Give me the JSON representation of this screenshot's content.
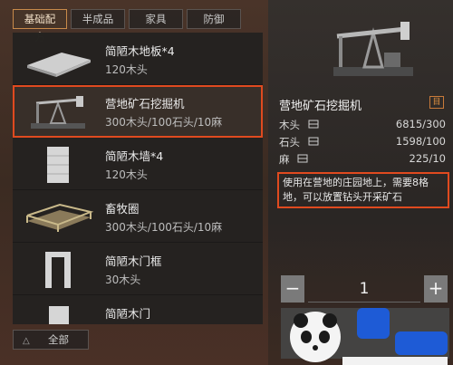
{
  "tabs": [
    {
      "label": "基础配方",
      "active": true
    },
    {
      "label": "半成品",
      "active": false
    },
    {
      "label": "家具",
      "active": false
    },
    {
      "label": "防御",
      "active": false
    }
  ],
  "recipes": [
    {
      "name": "简陋木地板*4",
      "cost": "120木头",
      "thumb": "floor-icon"
    },
    {
      "name": "营地矿石挖掘机",
      "cost": "300木头/100石头/10麻",
      "thumb": "pumpjack-icon",
      "selected": true
    },
    {
      "name": "简陋木墙*4",
      "cost": "120木头",
      "thumb": "wall-icon"
    },
    {
      "name": "畜牧圈",
      "cost": "300木头/100石头/10麻",
      "thumb": "pen-icon"
    },
    {
      "name": "简陋木门框",
      "cost": "30木头",
      "thumb": "doorframe-icon"
    },
    {
      "name": "简陋木门",
      "cost": "",
      "thumb": "door-icon"
    }
  ],
  "all_button": {
    "label": "全部"
  },
  "detail": {
    "title": "营地矿石挖掘机",
    "resources": [
      {
        "name": "木头",
        "value": "6815/300"
      },
      {
        "name": "石头",
        "value": "1598/100"
      },
      {
        "name": "麻",
        "value": "225/10"
      }
    ],
    "description": "使用在营地的庄园地上，需要8格地，可以放置钻头开采矿石"
  },
  "quantity": {
    "minus": "−",
    "value": "1",
    "plus": "+"
  },
  "colors": {
    "accent": "#e04a1f",
    "tab_border": "#c88a4a"
  }
}
